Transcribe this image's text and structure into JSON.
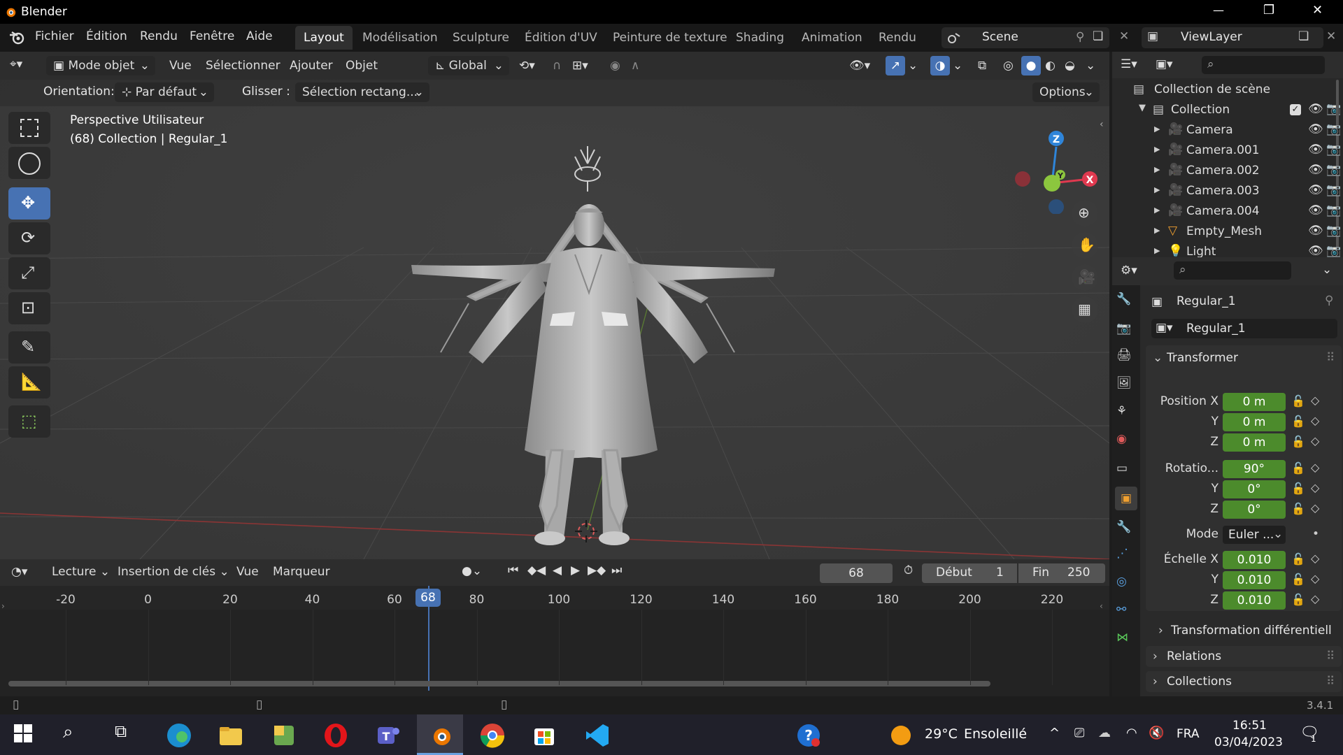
{
  "titlebar": {
    "app_title": "Blender",
    "minimize": "—",
    "maximize": "❐",
    "close": "✕"
  },
  "menu": {
    "items": [
      "Fichier",
      "Édition",
      "Rendu",
      "Fenêtre",
      "Aide"
    ]
  },
  "workspaces": {
    "tabs": [
      "Layout",
      "Modélisation",
      "Sculpture",
      "Édition d'UV",
      "Peinture de texture",
      "Shading",
      "Animation",
      "Rendu"
    ],
    "active": "Layout"
  },
  "scene": {
    "name": "Scene",
    "view_layer": "ViewLayer"
  },
  "viewport_header": {
    "mode": "Mode objet",
    "menus": [
      "Vue",
      "Sélectionner",
      "Ajouter",
      "Objet"
    ],
    "transform_space": "Global"
  },
  "tool_options": {
    "orientation_label": "Orientation:",
    "orientation_value": "Par défaut",
    "drag_label": "Glisser :",
    "drag_value": "Sélection rectang...",
    "options_label": "Options"
  },
  "viewport": {
    "view_name": "Perspective Utilisateur",
    "context": "(68) Collection | Regular_1",
    "gizmo": {
      "x": "X",
      "y": "Y",
      "z": "Z"
    }
  },
  "timeline": {
    "menus": [
      "Lecture",
      "Insertion de clés",
      "Vue",
      "Marqueur"
    ],
    "current_frame": "68",
    "start_label": "Début",
    "start_value": "1",
    "end_label": "Fin",
    "end_value": "250",
    "ruler": [
      "-20",
      "0",
      "20",
      "40",
      "60",
      "80",
      "100",
      "120",
      "140",
      "160",
      "180",
      "200",
      "220"
    ],
    "playhead_frame": "68"
  },
  "outliner": {
    "root": "Collection de scène",
    "collection": "Collection",
    "items": [
      "Camera",
      "Camera.001",
      "Camera.002",
      "Camera.003",
      "Camera.004",
      "Empty_Mesh",
      "Light"
    ]
  },
  "properties": {
    "object_name": "Regular_1",
    "data_name": "Regular_1",
    "transform_panel": "Transformer",
    "position_label": "Position X",
    "rotation_label": "Rotatio...",
    "scale_label": "Échelle X",
    "y": "Y",
    "z": "Z",
    "position": [
      "0 m",
      "0 m",
      "0 m"
    ],
    "rotation": [
      "90°",
      "0°",
      "0°"
    ],
    "scale": [
      "0.010",
      "0.010",
      "0.010"
    ],
    "mode_label": "Mode",
    "mode_value": "Euler ...",
    "delta_transform": "Transformation différentiell",
    "relations": "Relations",
    "collections": "Collections"
  },
  "status": {
    "version": "3.4.1"
  },
  "taskbar": {
    "weather_temp": "29°C",
    "weather_desc": "Ensoleillé",
    "language": "FRA",
    "time": "16:51",
    "date": "03/04/2023",
    "notif_count": "1"
  },
  "colors": {
    "accent": "#4772b3",
    "field_green": "#4c8b2c",
    "viewport_bg": "#3d3d3d",
    "axis_x": "#e0394f",
    "axis_y": "#8cc63e",
    "axis_z": "#2f85d9"
  }
}
